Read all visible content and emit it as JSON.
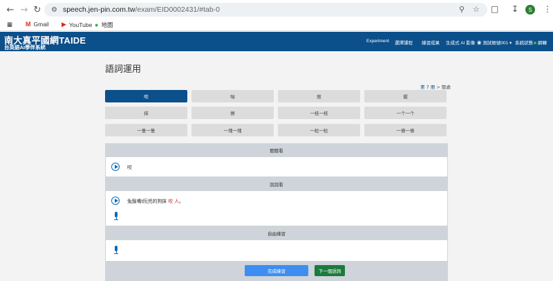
{
  "browser": {
    "url_host": "speech.jen-pin.com.tw",
    "url_path": "/exam/EID0002431/#tab-0",
    "avatar_letter": "S"
  },
  "bookmarks": [
    {
      "label": "Gmail",
      "icon": "gmail-icon"
    },
    {
      "label": "YouTube",
      "icon": "youtube-icon"
    },
    {
      "label": "地圖",
      "icon": "maps-icon"
    }
  ],
  "site": {
    "title": "南大真平國網TAIDE",
    "subtitle": "台英語AI學伴系統",
    "nav": [
      "Experiment",
      "選擇課程",
      "練習成果",
      "生成式 AI 影像",
      "測試帳號001",
      "系統狀態",
      "網轉"
    ]
  },
  "page": {
    "title": "語詞運用",
    "crumb_link": "第 7 冊",
    "crumb_rest": " > 聽處"
  },
  "words": [
    "咬",
    "喘",
    "敘",
    "擺",
    "抹",
    "擦",
    "一枝一枝",
    "一个一个",
    "一隻一隻",
    "一塊一塊",
    "一粒一粒",
    "一條一條"
  ],
  "listen": {
    "header": "聽聽看",
    "word": "咬"
  },
  "speak": {
    "header": "說說看",
    "sentence_pre": "兔鬚嘴t阮兜的狗抹 ",
    "sentence_hl": "咬 人",
    "sentence_post": "。"
  },
  "free": {
    "header": "自由練習"
  },
  "actions": {
    "finish": "完成練習",
    "next": "下一個語詞"
  },
  "colors": {
    "nav_bg": "#0b4f8b",
    "active_word": "#0b4f8b",
    "primary": "#3d8ef0",
    "success": "#1c7a3d",
    "highlight": "#c62828"
  }
}
